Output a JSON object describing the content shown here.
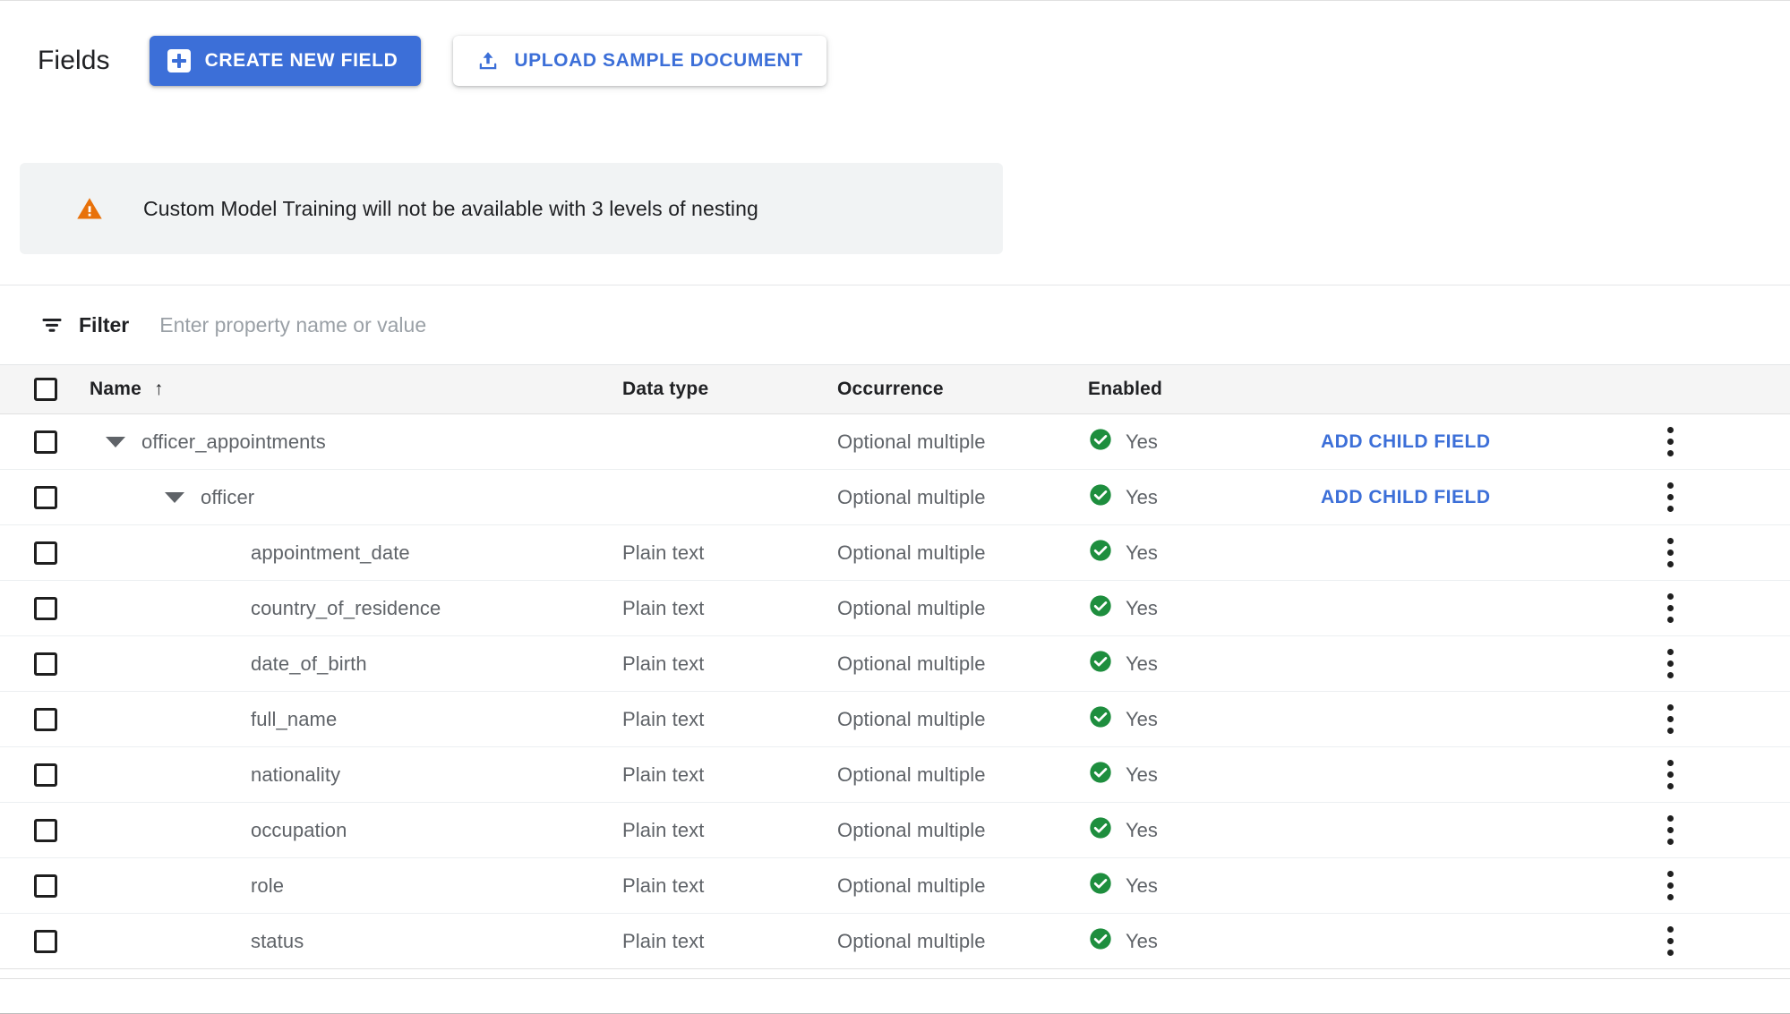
{
  "header": {
    "title": "Fields",
    "create_button": {
      "label": "CREATE NEW FIELD",
      "icon": "add-box-icon",
      "bg_color": "#3c6fd8",
      "text_color": "#ffffff"
    },
    "upload_button": {
      "label": "UPLOAD SAMPLE DOCUMENT",
      "icon": "upload-icon",
      "bg_color": "#ffffff",
      "text_color": "#3c6fd8"
    }
  },
  "banner": {
    "icon": "warning-triangle-icon",
    "icon_color": "#e8710a",
    "bg_color": "#f1f3f4",
    "message": "Custom Model Training will not be available with 3 levels of nesting"
  },
  "filter": {
    "icon": "filter-list-icon",
    "label": "Filter",
    "value": "",
    "placeholder": "Enter property name or value"
  },
  "table": {
    "select_all_checkbox": "unchecked",
    "columns": {
      "name": "Name",
      "sort_indicator": "↑",
      "data_type": "Data type",
      "occurrence": "Occurrence",
      "enabled": "Enabled"
    },
    "enabled_icon_color": "#1e8e3e",
    "action_link_color": "#3c6fd8",
    "rows": [
      {
        "name": "officer_appointments",
        "indent": 0,
        "expandable": true,
        "expanded": true,
        "data_type": "",
        "occurrence": "Optional multiple",
        "enabled": "Yes",
        "action": "ADD CHILD FIELD",
        "checkbox": "unchecked"
      },
      {
        "name": "officer",
        "indent": 1,
        "expandable": true,
        "expanded": true,
        "data_type": "",
        "occurrence": "Optional multiple",
        "enabled": "Yes",
        "action": "ADD CHILD FIELD",
        "checkbox": "unchecked"
      },
      {
        "name": "appointment_date",
        "indent": 2,
        "expandable": false,
        "expanded": false,
        "data_type": "Plain text",
        "occurrence": "Optional multiple",
        "enabled": "Yes",
        "action": "",
        "checkbox": "unchecked"
      },
      {
        "name": "country_of_residence",
        "indent": 2,
        "expandable": false,
        "expanded": false,
        "data_type": "Plain text",
        "occurrence": "Optional multiple",
        "enabled": "Yes",
        "action": "",
        "checkbox": "unchecked"
      },
      {
        "name": "date_of_birth",
        "indent": 2,
        "expandable": false,
        "expanded": false,
        "data_type": "Plain text",
        "occurrence": "Optional multiple",
        "enabled": "Yes",
        "action": "",
        "checkbox": "unchecked"
      },
      {
        "name": "full_name",
        "indent": 2,
        "expandable": false,
        "expanded": false,
        "data_type": "Plain text",
        "occurrence": "Optional multiple",
        "enabled": "Yes",
        "action": "",
        "checkbox": "unchecked"
      },
      {
        "name": "nationality",
        "indent": 2,
        "expandable": false,
        "expanded": false,
        "data_type": "Plain text",
        "occurrence": "Optional multiple",
        "enabled": "Yes",
        "action": "",
        "checkbox": "unchecked"
      },
      {
        "name": "occupation",
        "indent": 2,
        "expandable": false,
        "expanded": false,
        "data_type": "Plain text",
        "occurrence": "Optional multiple",
        "enabled": "Yes",
        "action": "",
        "checkbox": "unchecked"
      },
      {
        "name": "role",
        "indent": 2,
        "expandable": false,
        "expanded": false,
        "data_type": "Plain text",
        "occurrence": "Optional multiple",
        "enabled": "Yes",
        "action": "",
        "checkbox": "unchecked"
      },
      {
        "name": "status",
        "indent": 2,
        "expandable": false,
        "expanded": false,
        "data_type": "Plain text",
        "occurrence": "Optional multiple",
        "enabled": "Yes",
        "action": "",
        "checkbox": "unchecked"
      }
    ]
  }
}
